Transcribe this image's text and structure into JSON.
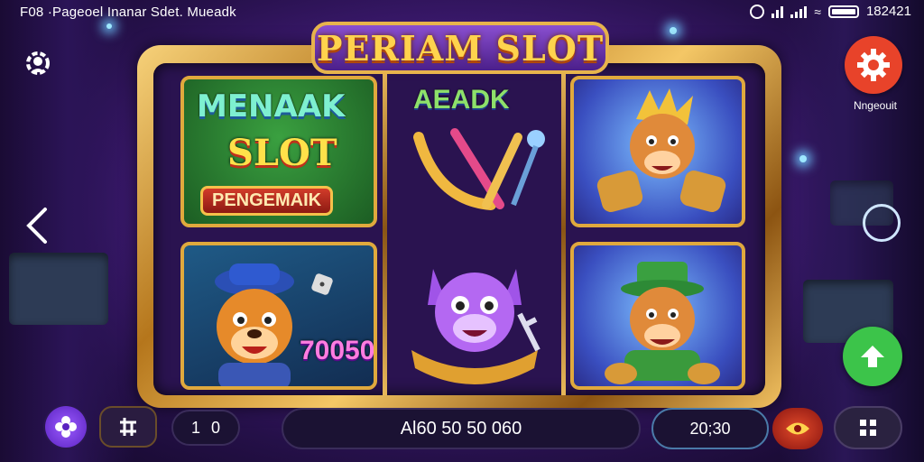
{
  "status_bar": {
    "left_text": "F08 ·Pageoel Inanar Sdet. Mueadk",
    "clock": "182421"
  },
  "game": {
    "title": "PERIAM SLOT",
    "reel1_top": {
      "line1": "MENAAK",
      "line2": "SLOT",
      "banner": "PENGEMAIK"
    },
    "reel1_bottom": {
      "badge": "70050"
    },
    "reel2_top": {
      "label": "AEADK"
    },
    "reel2_bottom": {
      "ribbon": "~~~~~"
    }
  },
  "side": {
    "settings_label": "Nngeouit"
  },
  "bottom_bar": {
    "bet_value": "1",
    "bet_value2": "0",
    "balance": "Al60 50 50 060",
    "win": "20;30"
  },
  "colors": {
    "accent_gold": "#e7b44c",
    "settings_red": "#e8432a",
    "up_green": "#3cc44a",
    "flower_purple": "#7b3ee0"
  },
  "icons": [
    "user-settings-icon",
    "back-arrow-icon",
    "circle-outline-icon",
    "gear-icon",
    "up-arrow-icon",
    "flower-icon",
    "hash-icon",
    "eye-icon",
    "grid-icon"
  ]
}
